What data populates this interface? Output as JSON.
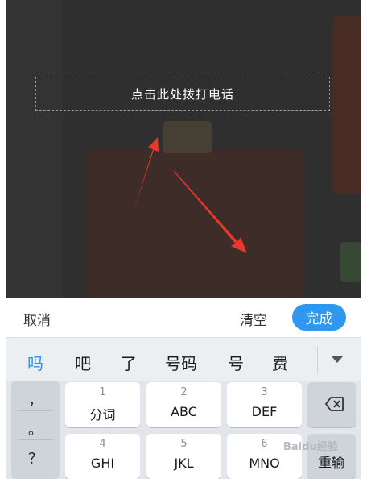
{
  "dialog": {
    "text": "点击此处拨打电话"
  },
  "action_bar": {
    "cancel": "取消",
    "clear": "清空",
    "done": "完成"
  },
  "candidates": [
    "吗",
    "吧",
    "了",
    "号码",
    "号",
    "费"
  ],
  "keyboard": {
    "punctuation": [
      "，",
      "。",
      "？"
    ],
    "keys": [
      {
        "num": "1",
        "letters": "分词"
      },
      {
        "num": "2",
        "letters": "ABC"
      },
      {
        "num": "3",
        "letters": "DEF"
      },
      {
        "num": "4",
        "letters": "GHI"
      },
      {
        "num": "5",
        "letters": "JKL"
      },
      {
        "num": "6",
        "letters": "MNO"
      }
    ],
    "reenter": "重输"
  },
  "watermark": "Baidu经验"
}
